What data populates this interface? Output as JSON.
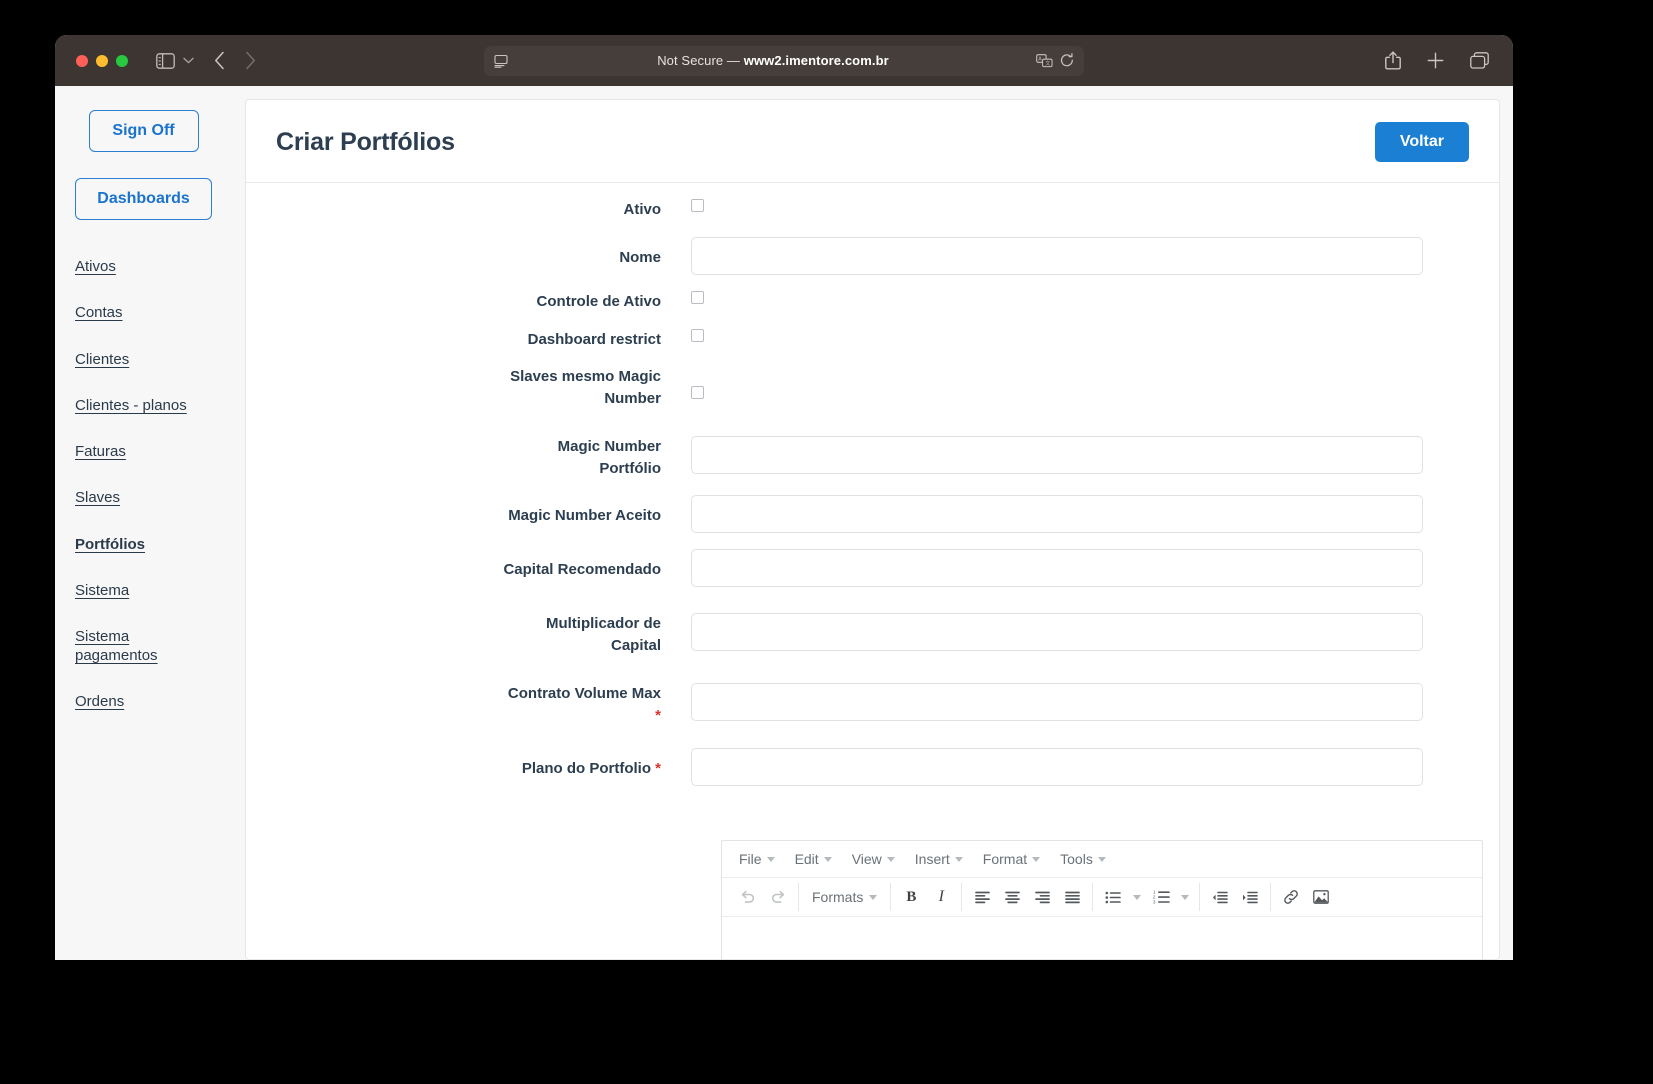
{
  "browser": {
    "url_prefix": "Not Secure — ",
    "url_host": "www2.imentore.com.br",
    "sidebar_toggle_icon": "sidebar-icon",
    "sidebar_chevron_icon": "chevron-down-icon",
    "back_icon": "chevron-left-icon",
    "forward_icon": "chevron-right-icon",
    "reader_icon": "reader-view-icon",
    "translate_icon": "translate-icon",
    "reload_icon": "reload-icon",
    "share_icon": "share-icon",
    "new_tab_icon": "plus-icon",
    "tab_overview_icon": "tab-overview-icon"
  },
  "sidebar": {
    "sign_off_label": "Sign Off",
    "dashboards_label": "Dashboards",
    "links": [
      {
        "label": "Ativos",
        "active": false
      },
      {
        "label": "Contas",
        "active": false
      },
      {
        "label": "Clientes",
        "active": false
      },
      {
        "label": "Clientes - planos",
        "active": false
      },
      {
        "label": "Faturas",
        "active": false
      },
      {
        "label": "Slaves",
        "active": false
      },
      {
        "label": "Portfólios",
        "active": true
      },
      {
        "label": "Sistema",
        "active": false
      },
      {
        "label": "Sistema pagamentos",
        "active": false
      },
      {
        "label": "Ordens",
        "active": false
      }
    ]
  },
  "header": {
    "title": "Criar Portfólios",
    "back_button_label": "Voltar",
    "accent_color": "#1b7fd4"
  },
  "form": {
    "required_marker": "*",
    "fields": [
      {
        "label": "Ativo",
        "type": "checkbox",
        "value": "",
        "required": false
      },
      {
        "label": "Nome",
        "type": "text",
        "value": "",
        "required": false
      },
      {
        "label": "Controle de Ativo",
        "type": "checkbox",
        "value": "",
        "required": false
      },
      {
        "label": "Dashboard restrict",
        "type": "checkbox",
        "value": "",
        "required": false
      },
      {
        "label": "Slaves mesmo Magic Number",
        "type": "checkbox",
        "value": "",
        "required": false
      },
      {
        "label": "Magic Number Portfólio",
        "type": "text",
        "value": "",
        "required": false
      },
      {
        "label": "Magic Number Aceito",
        "type": "text",
        "value": "",
        "required": false
      },
      {
        "label": "Capital Recomendado",
        "type": "text",
        "value": "",
        "required": false
      },
      {
        "label": "Multiplicador de Capital",
        "type": "text",
        "value": "",
        "required": false
      },
      {
        "label": "Contrato Volume Max",
        "type": "text",
        "value": "",
        "required": true
      },
      {
        "label": "Plano do Portfolio",
        "type": "text",
        "value": "",
        "required": true
      }
    ]
  },
  "editor": {
    "menu": [
      {
        "label": "File"
      },
      {
        "label": "Edit"
      },
      {
        "label": "View"
      },
      {
        "label": "Insert"
      },
      {
        "label": "Format"
      },
      {
        "label": "Tools"
      }
    ],
    "formats_label": "Formats",
    "toolbar_icons": [
      "undo-icon",
      "redo-icon",
      "formats-dropdown",
      "bold-icon",
      "italic-icon",
      "align-left-icon",
      "align-center-icon",
      "align-right-icon",
      "align-justify-icon",
      "bullet-list-icon",
      "bullet-list-caret",
      "numbered-list-icon",
      "numbered-list-caret",
      "outdent-icon",
      "indent-icon",
      "link-icon",
      "image-icon"
    ],
    "content": ""
  }
}
